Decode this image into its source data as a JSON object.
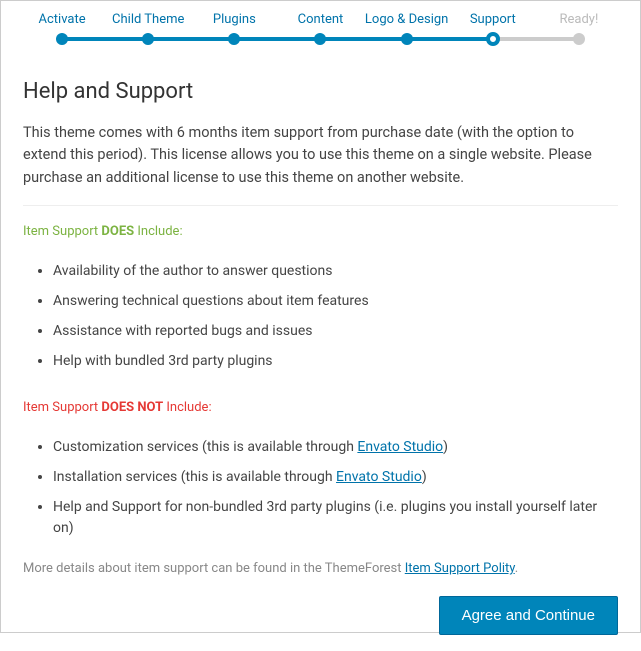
{
  "steps": [
    {
      "label": "Activate",
      "state": "done"
    },
    {
      "label": "Child Theme",
      "state": "done"
    },
    {
      "label": "Plugins",
      "state": "done"
    },
    {
      "label": "Content",
      "state": "done"
    },
    {
      "label": "Logo & Design",
      "state": "done"
    },
    {
      "label": "Support",
      "state": "current"
    },
    {
      "label": "Ready!",
      "state": "disabled"
    }
  ],
  "title": "Help and Support",
  "intro": "This theme comes with 6 months item support from purchase date (with the option to extend this period). This license allows you to use this theme on a single website. Please purchase an additional license to use this theme on another website.",
  "does_header_prefix": "Item Support ",
  "does_header_strong": "DOES",
  "does_header_suffix": " Include:",
  "does_list": [
    "Availability of the author to answer questions",
    "Answering technical questions about item features",
    "Assistance with reported bugs and issues",
    "Help with bundled 3rd party plugins"
  ],
  "doesnot_header_prefix": "Item Support ",
  "doesnot_header_strong": "DOES NOT",
  "doesnot_header_suffix": " Include:",
  "doesnot_list": {
    "item0_prefix": "Customization services (this is available through ",
    "item0_link": "Envato Studio",
    "item0_suffix": ")",
    "item1_prefix": "Installation services (this is available through ",
    "item1_link": "Envato Studio",
    "item1_suffix": ")",
    "item2": "Help and Support for non-bundled 3rd party plugins (i.e. plugins you install yourself later on)"
  },
  "footer_prefix": "More details about item support can be found in the ThemeForest ",
  "footer_link": "Item Support Polity",
  "footer_suffix": ".",
  "continue_button": "Agree and Continue"
}
